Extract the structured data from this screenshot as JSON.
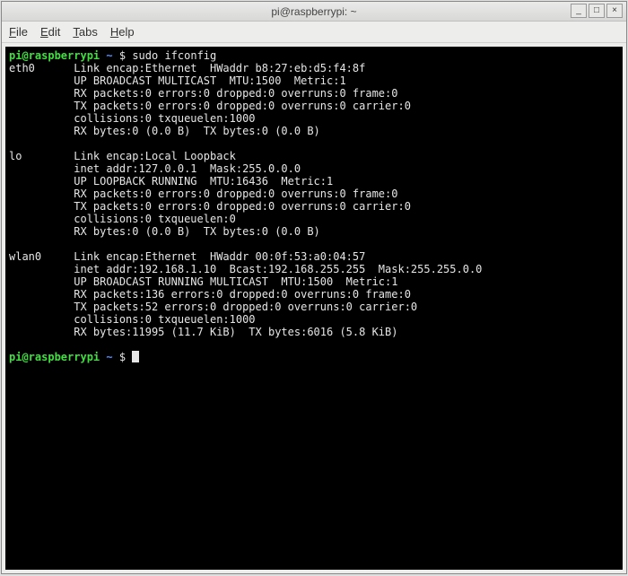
{
  "window": {
    "title": "pi@raspberrypi: ~",
    "buttons": {
      "min": "_",
      "max": "□",
      "close": "×"
    }
  },
  "menubar": {
    "file": "File",
    "edit": "Edit",
    "tabs": "Tabs",
    "help": "Help"
  },
  "prompt": {
    "user_host": "pi@raspberrypi",
    "path": "~",
    "symbol": "$"
  },
  "command": "sudo ifconfig",
  "interfaces": [
    {
      "name": "eth0",
      "lines": [
        "Link encap:Ethernet  HWaddr b8:27:eb:d5:f4:8f",
        "UP BROADCAST MULTICAST  MTU:1500  Metric:1",
        "RX packets:0 errors:0 dropped:0 overruns:0 frame:0",
        "TX packets:0 errors:0 dropped:0 overruns:0 carrier:0",
        "collisions:0 txqueuelen:1000",
        "RX bytes:0 (0.0 B)  TX bytes:0 (0.0 B)"
      ]
    },
    {
      "name": "lo",
      "lines": [
        "Link encap:Local Loopback",
        "inet addr:127.0.0.1  Mask:255.0.0.0",
        "UP LOOPBACK RUNNING  MTU:16436  Metric:1",
        "RX packets:0 errors:0 dropped:0 overruns:0 frame:0",
        "TX packets:0 errors:0 dropped:0 overruns:0 carrier:0",
        "collisions:0 txqueuelen:0",
        "RX bytes:0 (0.0 B)  TX bytes:0 (0.0 B)"
      ]
    },
    {
      "name": "wlan0",
      "lines": [
        "Link encap:Ethernet  HWaddr 00:0f:53:a0:04:57",
        "inet addr:192.168.1.10  Bcast:192.168.255.255  Mask:255.255.0.0",
        "UP BROADCAST RUNNING MULTICAST  MTU:1500  Metric:1",
        "RX packets:136 errors:0 dropped:0 overruns:0 frame:0",
        "TX packets:52 errors:0 dropped:0 overruns:0 carrier:0",
        "collisions:0 txqueuelen:1000",
        "RX bytes:11995 (11.7 KiB)  TX bytes:6016 (5.8 KiB)"
      ]
    }
  ]
}
